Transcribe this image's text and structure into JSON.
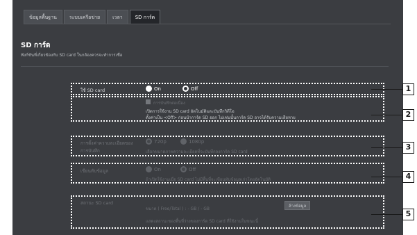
{
  "tabs": [
    {
      "label": "ข้อมูลพื้นฐาน",
      "active": false
    },
    {
      "label": "ระบบเครือข่าย",
      "active": false
    },
    {
      "label": "เวลา",
      "active": false
    },
    {
      "label": "SD การ์ด",
      "active": true
    }
  ],
  "page": {
    "title": "SD การ์ด",
    "description": "ฟังก์ชันที่เกี่ยวข้องกับ SD card ในกล้องควรจะทำการเชื่อ"
  },
  "sections": {
    "use_sd": {
      "label": "ใช้ SD card",
      "on_label": "On",
      "off_label": "Off",
      "selected": "Off",
      "checkbox_label": "การบันทึกต่อเนื่อง",
      "note_line1": "เปิดการใช้งาน SD card อัตโนมัติและบันทึกวิดีโอ",
      "note_line2": "ตั้งค่าเป็น <Off> ก่อนนำการ์ด SD ออก ไม่เช่นนั้นการ์ด SD อาจได้รับความเสียหาย"
    },
    "recording": {
      "label_line1": "การตั้งค่าความละเอียดของ",
      "label_line2": "การบันทึก",
      "opt1": "720p",
      "opt2": "1080p",
      "selected": "720p",
      "note": "เลือกขนาดภาพความละเอียดที่จะบันทึกลงการ์ด SD card"
    },
    "overwrite": {
      "label": "เขียนทับข้อมูล",
      "on_label": "On",
      "off_label": "Off",
      "selected": "Off",
      "note": "ถ้าเปิดใช้งานเมื่อ SD card ไม่มีพื้นที่จะเขียนทับข้อมูลเก่าโดยอัตโนมัติ"
    },
    "status": {
      "label": "สถานะ SD card",
      "size_text": "ขนาด ( Free/Total ) : - GB / - GB",
      "clear_button": "ล้างข้อมูล",
      "note": "แสดงสถานะของพื้นที่ว่างของการ์ด SD card ที่ใช้งานในขณะนี้"
    }
  },
  "callouts": [
    "1",
    "2",
    "3",
    "4",
    "5"
  ]
}
